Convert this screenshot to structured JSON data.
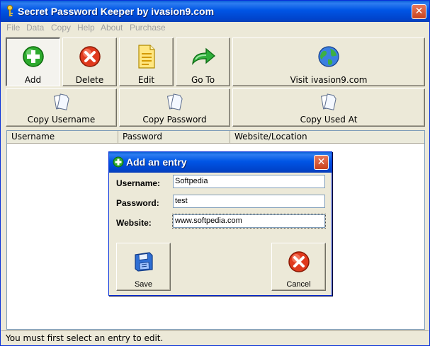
{
  "window": {
    "title": "Secret Password Keeper by ivasion9.com",
    "close_glyph": "✕"
  },
  "menu": [
    "File",
    "Data",
    "Copy",
    "Help",
    "About",
    "Purchase"
  ],
  "toolbar": {
    "add": "Add",
    "delete": "Delete",
    "edit": "Edit",
    "goto": "Go To",
    "visit": "Visit ivasion9.com",
    "copy_username": "Copy Username",
    "copy_password": "Copy Password",
    "copy_used_at": "Copy Used At"
  },
  "list": {
    "columns": [
      "Username",
      "Password",
      "Website/Location"
    ]
  },
  "status": "You must first select an entry to edit.",
  "dialog": {
    "title": "Add an entry",
    "close_glyph": "✕",
    "username_label": "Username:",
    "username_value": "Softpedia",
    "password_label": "Password:",
    "password_value": "test",
    "website_label": "Website:",
    "website_value": "www.softpedia.com",
    "save": "Save",
    "cancel": "Cancel"
  },
  "icons": {
    "add": "plus-circle-icon",
    "delete": "x-circle-icon",
    "edit": "document-icon",
    "goto": "arrow-icon",
    "visit": "globe-icon",
    "copy": "copy-pages-icon",
    "save": "floppy-disk-icon",
    "cancel": "x-circle-icon"
  },
  "colors": {
    "titlebar": "#0055e5",
    "window_bg": "#ece9d8",
    "close": "#c8421e",
    "add_green": "#2eaa2e",
    "delete_red": "#e03a1e"
  }
}
